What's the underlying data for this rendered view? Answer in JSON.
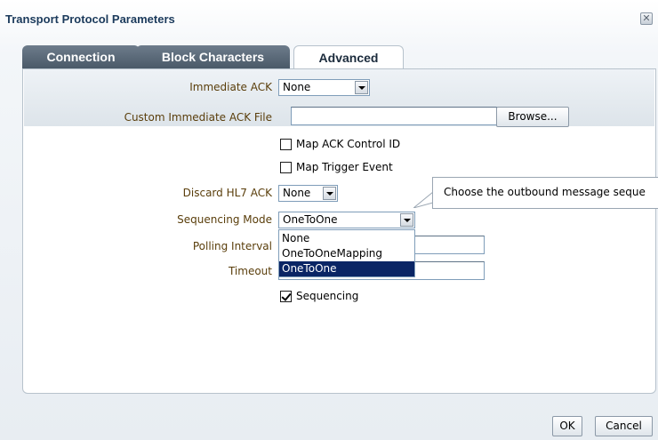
{
  "dialog": {
    "title": "Transport Protocol Parameters"
  },
  "tabs": [
    {
      "label": "Connection"
    },
    {
      "label": "Block Characters"
    },
    {
      "label": "Advanced",
      "active": true
    }
  ],
  "form": {
    "immediate_ack": {
      "label": "Immediate ACK",
      "value": "None"
    },
    "custom_ack_file": {
      "label": "Custom Immediate ACK File",
      "value": "",
      "browse_label": "Browse..."
    },
    "map_ack_control_id": {
      "label": "Map ACK Control ID",
      "checked": false
    },
    "map_trigger_event": {
      "label": "Map Trigger Event",
      "checked": false
    },
    "discard_hl7_ack": {
      "label": "Discard HL7 ACK",
      "value": "None"
    },
    "sequencing_mode": {
      "label": "Sequencing Mode",
      "value": "OneToOne",
      "options": [
        "None",
        "OneToOneMapping",
        "OneToOne"
      ],
      "selected_option": "OneToOne"
    },
    "polling_interval": {
      "label": "Polling Interval",
      "value": ""
    },
    "timeout": {
      "label": "Timeout",
      "value": ""
    },
    "sequencing": {
      "label": "Sequencing",
      "checked": true
    }
  },
  "tooltip": {
    "text": "Choose the outbound message seque"
  },
  "footer": {
    "ok_label": "OK",
    "cancel_label": "Cancel"
  },
  "colors": {
    "title": "#1b3a5c",
    "label": "#5a3e0b",
    "selected": "#0a2565",
    "tab_inactive": "#4a5968"
  },
  "icons": {
    "close": "close-icon",
    "dropdown": "chevron-down-icon",
    "check": "check-icon"
  }
}
